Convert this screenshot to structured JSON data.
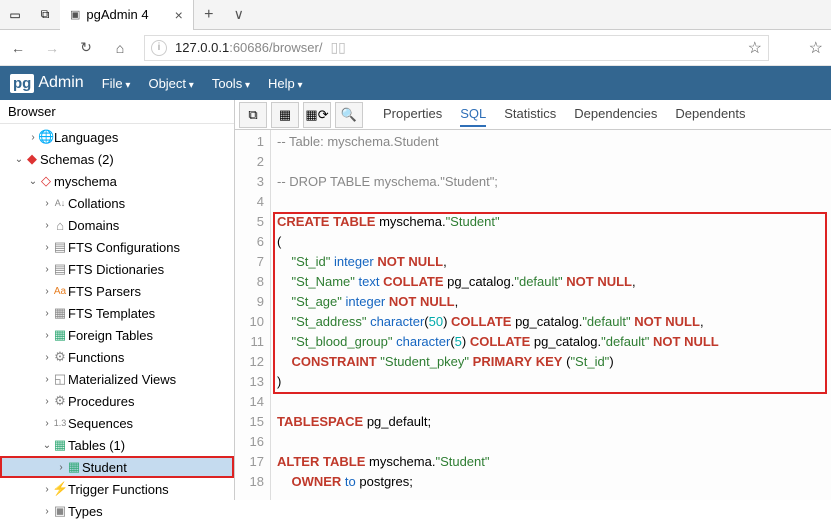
{
  "browser": {
    "tab_title": "pgAdmin 4",
    "url_host": "127.0.0.1",
    "url_rest": ":60686/browser/"
  },
  "pga": {
    "logo_prefix": "pg",
    "logo_text": "Admin",
    "menus": [
      "File",
      "Object",
      "Tools",
      "Help"
    ]
  },
  "sidebar": {
    "title": "Browser",
    "tree": {
      "languages": "Languages",
      "schemas": "Schemas (2)",
      "myschema": "myschema",
      "collations": "Collations",
      "domains": "Domains",
      "fts_conf": "FTS Configurations",
      "fts_dict": "FTS Dictionaries",
      "fts_parsers": "FTS Parsers",
      "fts_tmpl": "FTS Templates",
      "foreign": "Foreign Tables",
      "functions": "Functions",
      "matviews": "Materialized Views",
      "procedures": "Procedures",
      "sequences": "Sequences",
      "tables": "Tables (1)",
      "student": "Student",
      "trigfn": "Trigger Functions",
      "types": "Types"
    }
  },
  "toolbar": {
    "tabs": [
      "Properties",
      "SQL",
      "Statistics",
      "Dependencies",
      "Dependents"
    ]
  },
  "sql": {
    "lines": [
      "-- Table: myschema.Student",
      "",
      "-- DROP TABLE myschema.\"Student\";",
      "",
      "CREATE TABLE myschema.\"Student\"",
      "(",
      "    \"St_id\" integer NOT NULL,",
      "    \"St_Name\" text COLLATE pg_catalog.\"default\" NOT NULL,",
      "    \"St_age\" integer NOT NULL,",
      "    \"St_address\" character(50) COLLATE pg_catalog.\"default\" NOT NULL,",
      "    \"St_blood_group\" character(5) COLLATE pg_catalog.\"default\" NOT NULL",
      "    CONSTRAINT \"Student_pkey\" PRIMARY KEY (\"St_id\")",
      ")",
      "",
      "TABLESPACE pg_default;",
      "",
      "ALTER TABLE myschema.\"Student\"",
      "    OWNER to postgres;"
    ]
  }
}
